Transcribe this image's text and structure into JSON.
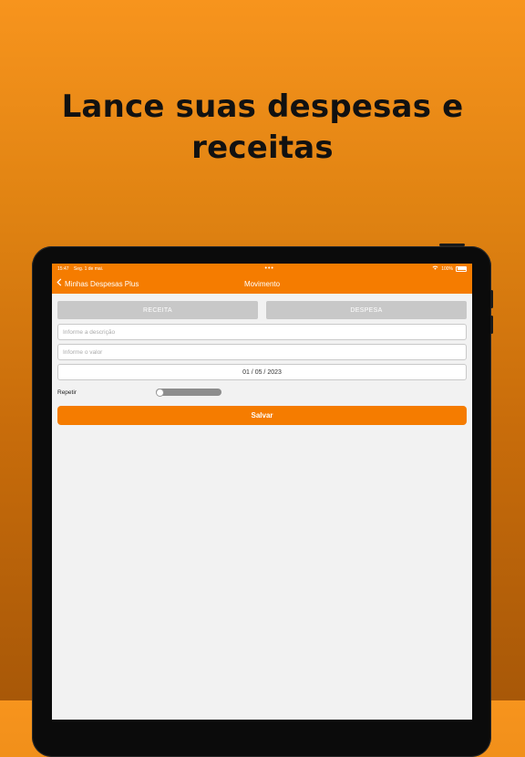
{
  "headline": {
    "line1": "Lance suas despesas e",
    "line2": "receitas"
  },
  "status_bar": {
    "time": "15:47",
    "date": "Seg. 1 de mai.",
    "dots": "•••",
    "wifi_icon": "wifi-icon",
    "battery_percent": "100%"
  },
  "navbar": {
    "back_label": "Minhas Despesas Plus",
    "title": "Movimento",
    "back_icon": "chevron-left-icon"
  },
  "form": {
    "type_receita": "RECEITA",
    "type_despesa": "DESPESA",
    "description_placeholder": "Informe a descrição",
    "value_placeholder": "Informe o valor",
    "date_value": "01 / 05 / 2023",
    "repeat_label": "Repetir",
    "repeat_on": false,
    "save_label": "Salvar"
  },
  "colors": {
    "accent": "#f57c00",
    "background_top": "#f7941d",
    "background_bottom": "#a85808"
  }
}
